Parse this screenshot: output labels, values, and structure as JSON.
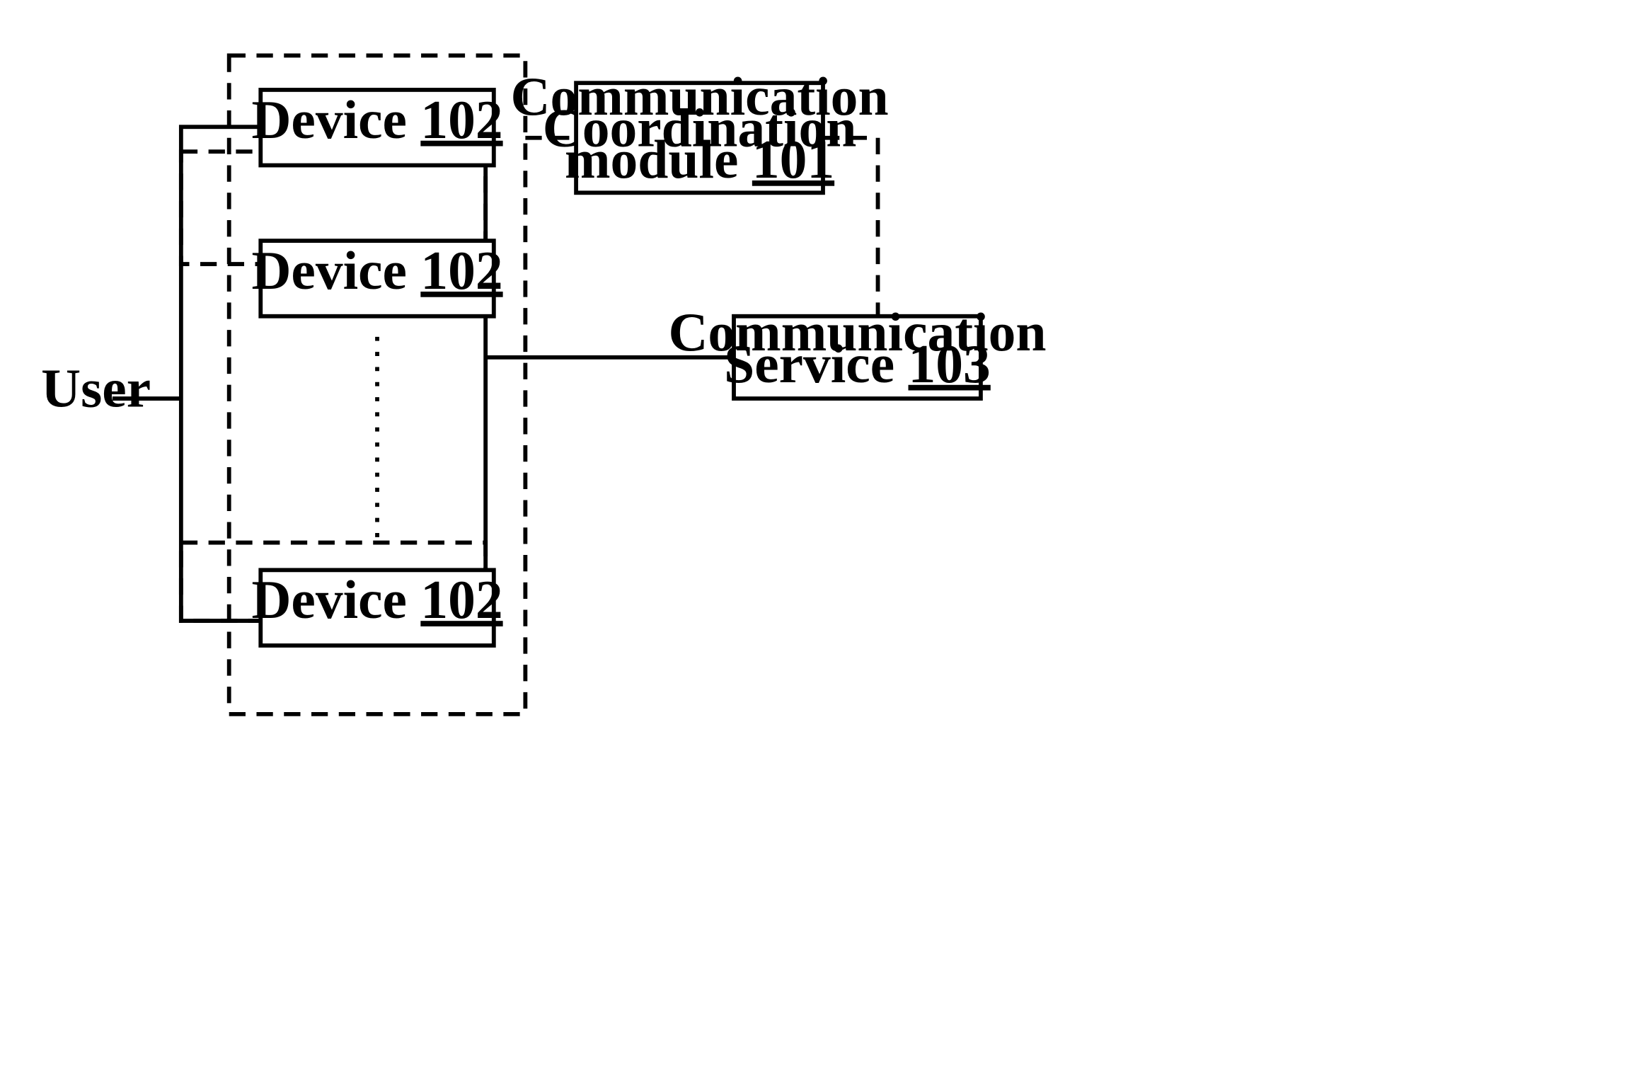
{
  "diagram": {
    "user_label": "User",
    "device1": {
      "name": "Device",
      "ref": "102"
    },
    "device2": {
      "name": "Device",
      "ref": "102"
    },
    "device3": {
      "name": "Device",
      "ref": "102"
    },
    "coord": {
      "line1": "Communication",
      "line2": "Coordination",
      "line3_a": "module",
      "line3_b": "101"
    },
    "service": {
      "line1": "Communication",
      "line2_a": "Service",
      "line2_b": "103"
    }
  }
}
